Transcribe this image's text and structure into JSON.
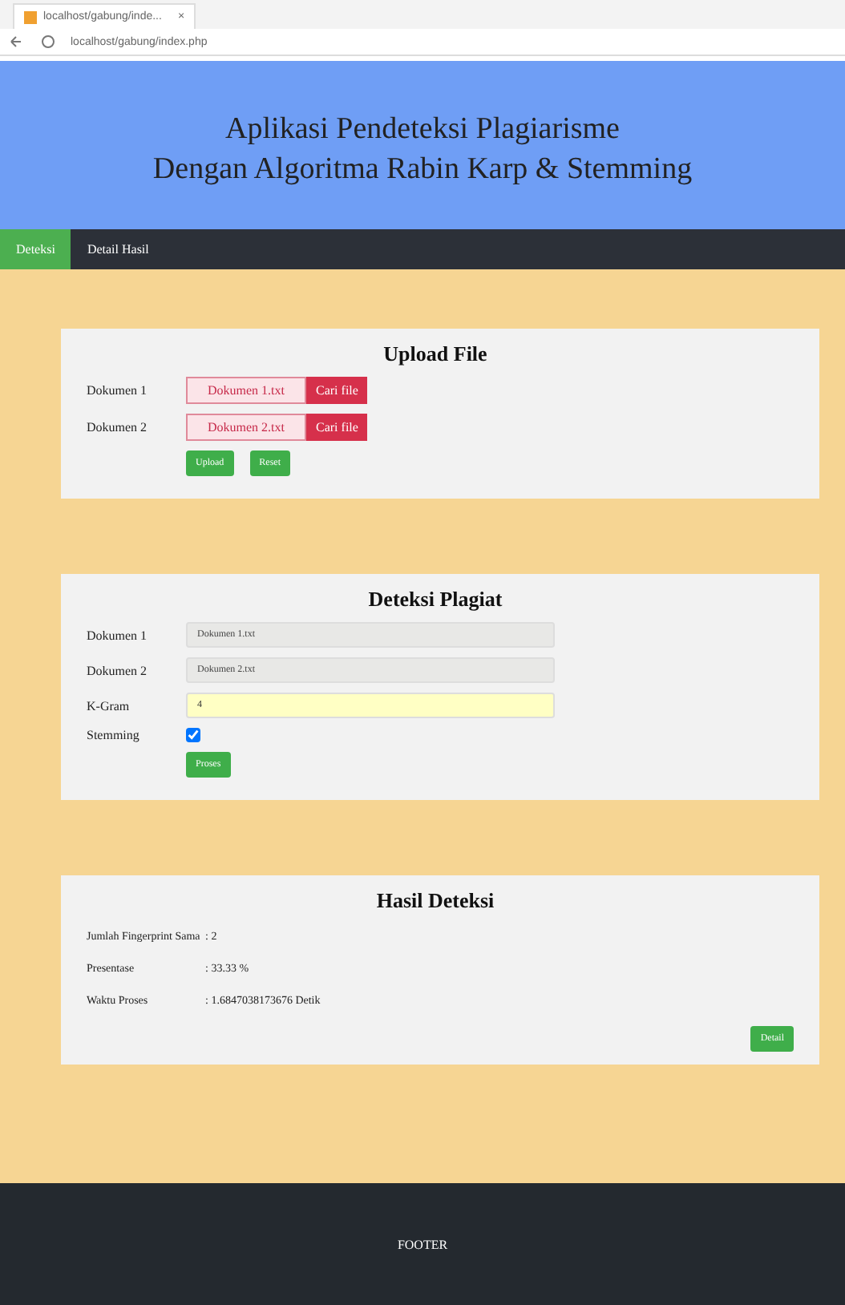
{
  "browser": {
    "tab_title": "localhost/gabung/inde...",
    "tab_close": "×",
    "url": "localhost/gabung/index.php"
  },
  "header": {
    "title_line1": "Aplikasi Pendeteksi Plagiarisme",
    "title_line2": "Dengan Algoritma Rabin Karp & Stemming"
  },
  "nav": [
    {
      "label": "Deteksi",
      "selected": true
    },
    {
      "label": "Detail Hasil",
      "selected": false
    }
  ],
  "upload": {
    "title": "Upload File",
    "files": [
      {
        "label": "Dokumen 1",
        "file": "Dokumen 1.txt",
        "button": "Cari file"
      },
      {
        "label": "Dokumen 2",
        "file": "Dokumen 2.txt",
        "button": "Cari file"
      }
    ],
    "buttons": [
      "Upload",
      "Reset"
    ]
  },
  "deteksi": {
    "title": "Deteksi Plagiat",
    "fields": [
      {
        "label": "Dokumen 1",
        "value": "Dokumen 1.txt",
        "kind": "readonly"
      },
      {
        "label": "Dokumen 2",
        "value": "Dokumen 2.txt",
        "kind": "readonly"
      },
      {
        "label": "K-Gram",
        "value": "4",
        "kind": "highlight"
      }
    ],
    "stemming": {
      "label": "Stemming",
      "checked": true
    },
    "button": "Proses"
  },
  "hasil": {
    "title": "Hasil Deteksi",
    "rows": [
      {
        "label": "Jumlah Fingerprint Sama",
        "value": ": 2"
      },
      {
        "label": "Presentase",
        "value": ": 33.33 %"
      },
      {
        "label": "Waktu Proses",
        "value": ": 1.6847038173676 Detik"
      }
    ],
    "button": "Detail"
  },
  "footer": "FOOTER"
}
